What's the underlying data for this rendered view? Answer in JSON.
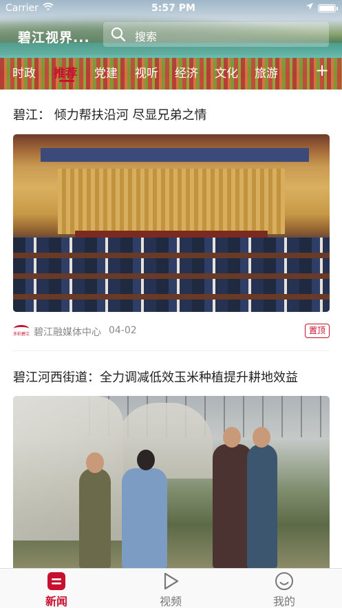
{
  "status_bar": {
    "carrier": "Carrier",
    "time": "5:57 PM",
    "wifi_icon": "wifi-icon",
    "location_icon": "location-arrow-icon",
    "battery_level": 1.0
  },
  "header": {
    "app_title": "碧江视界...",
    "search_placeholder": "搜索",
    "search_icon": "search-icon",
    "add_channel_label": "+"
  },
  "channels": [
    {
      "label": "时政",
      "active": false
    },
    {
      "label": "推荐",
      "active": true
    },
    {
      "label": "党建",
      "active": false
    },
    {
      "label": "视听",
      "active": false
    },
    {
      "label": "经济",
      "active": false
    },
    {
      "label": "文化",
      "active": false
    },
    {
      "label": "旅游",
      "active": false
    }
  ],
  "articles": [
    {
      "title": "碧江：  倾力帮扶沿河  尽显兄弟之情",
      "image_subject": "meeting-hall-photo",
      "source_logo_text": "多彩碧江",
      "source": "碧江融媒体中心",
      "date": "04-02",
      "badge": "置顶"
    },
    {
      "title": "碧江河西街道：全力调减低效玉米种植提升耕地效益",
      "image_subject": "greenhouse-field-photo"
    }
  ],
  "tabbar": [
    {
      "label": "新闻",
      "icon": "news-icon",
      "active": true
    },
    {
      "label": "视频",
      "icon": "play-icon",
      "active": false
    },
    {
      "label": "我的",
      "icon": "smiley-face-icon",
      "active": false
    }
  ],
  "colors": {
    "accent": "#c8102e",
    "text_primary": "#222222",
    "text_secondary": "#888888"
  }
}
